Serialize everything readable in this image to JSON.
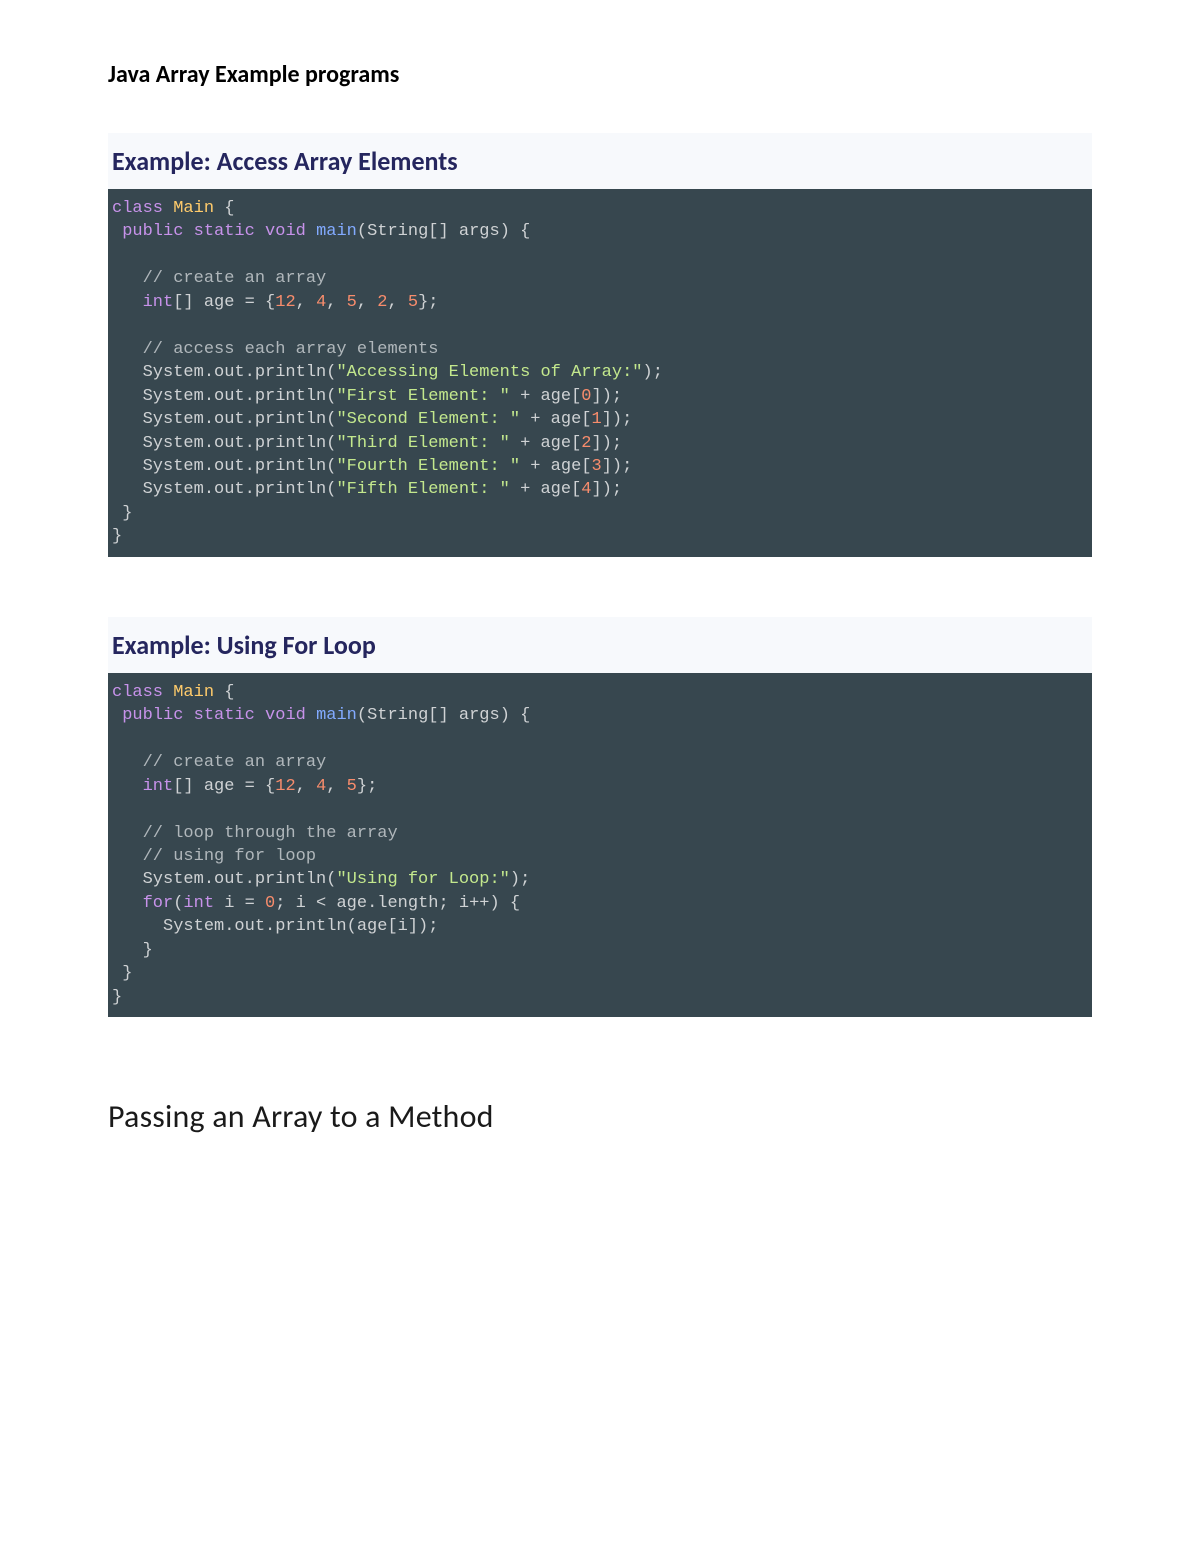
{
  "page_title": "Java Array Example programs",
  "examples": [
    {
      "heading": "Example: Access Array Elements"
    },
    {
      "heading": "Example: Using For Loop"
    }
  ],
  "subheading": "Passing an Array to a Method",
  "code1": {
    "class_kw": "class",
    "class_name": "Main",
    "open_brace": " {",
    "public": " public",
    "static": "static",
    "void": "void",
    "main": "main",
    "main_sig": "(String[] args) {",
    "cmt_create": "   // create an array",
    "int_kw": "   int",
    "arr_decl_mid": "[] age = {",
    "n12": "12",
    "n4": "4",
    "n5": "5",
    "n2": "2",
    "n5b": "5",
    "arr_decl_end": "};",
    "cmt_access": "   // access each array elements",
    "sys_prefix": "   System.out.println(",
    "str_title": "\"Accessing Elements of Array:\"",
    "close_call": ");",
    "str_first": "\"First Element: \"",
    "plus_age": " + age[",
    "idx0": "0",
    "idx_close": "]);",
    "str_second": "\"Second Element: \"",
    "idx1": "1",
    "str_third": "\"Third Element: \"",
    "idx2": "2",
    "str_fourth": "\"Fourth Element: \"",
    "idx3": "3",
    "str_fifth": "\"Fifth Element: \"",
    "idx4": "4",
    "close_method": " }",
    "close_class": "}"
  },
  "code2": {
    "class_kw": "class",
    "class_name": "Main",
    "open_brace": " {",
    "public": " public",
    "static": "static",
    "void": "void",
    "main": "main",
    "main_sig": "(String[] args) {",
    "cmt_create": "   // create an array",
    "int_kw": "   int",
    "arr_decl_mid": "[] age = {",
    "n12": "12",
    "n4": "4",
    "n5": "5",
    "arr_decl_end": "};",
    "cmt_loop1": "   // loop through the array",
    "cmt_loop2": "   // using for loop",
    "sys_prefix": "   System.out.println(",
    "str_loop": "\"Using for Loop:\"",
    "close_call": ");",
    "for_kw": "   for",
    "for_open": "(",
    "int_i": "int",
    "i_eq": " i = ",
    "zero": "0",
    "for_rest": "; i < age.length; i++) {",
    "body": "     System.out.println(age[i]);",
    "close_for": "   }",
    "close_method": " }",
    "close_class": "}"
  }
}
